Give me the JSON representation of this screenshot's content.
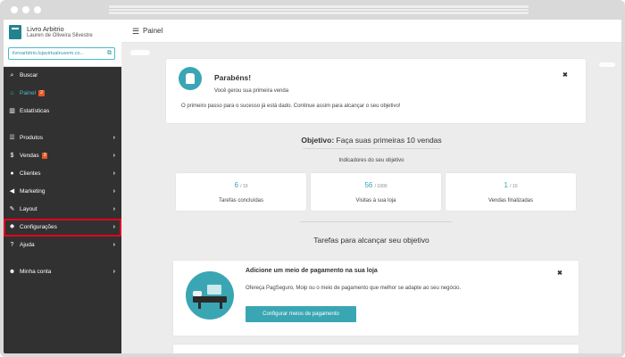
{
  "store": {
    "name": "Livro Arbitrio",
    "owner": "Lauren de Oliveira Silvestre",
    "url": "livroarbitrio.lojavirtualnuvem.co..."
  },
  "topbar": {
    "title": "Painel"
  },
  "sidebar": {
    "items": [
      {
        "label": "Buscar",
        "icon": "search-icon"
      },
      {
        "label": "Painel",
        "badge": "2",
        "icon": "home-icon"
      },
      {
        "label": "Estatísticas",
        "icon": "bar-chart-icon"
      },
      {
        "label": "Produtos",
        "icon": "list-icon"
      },
      {
        "label": "Vendas",
        "badge": "3",
        "icon": "dollar-icon"
      },
      {
        "label": "Clientes",
        "icon": "users-icon"
      },
      {
        "label": "Marketing",
        "icon": "megaphone-icon"
      },
      {
        "label": "Layout",
        "icon": "brush-icon"
      },
      {
        "label": "Configurações",
        "icon": "gear-icon"
      },
      {
        "label": "Ajuda",
        "icon": "help-icon"
      },
      {
        "label": "Minha conta",
        "icon": "user-icon"
      }
    ]
  },
  "congrats": {
    "title": "Parabéns!",
    "subtitle": "Você gerou sua primeira venda",
    "message": "O primeiro passo para o sucesso já está dado. Continue assim para alcançar o seu objetivo!"
  },
  "objective": {
    "label": "Objetivo:",
    "text": "Faça suas primeiras 10 vendas",
    "indicators_label": "Indicadores do seu objetivo"
  },
  "stats": [
    {
      "value": "6",
      "total": "/ 19",
      "label": "Tarefas concluídas"
    },
    {
      "value": "56",
      "total": "/ 1000",
      "label": "Visitas à sua loja"
    },
    {
      "value": "1",
      "total": "/ 10",
      "label": "Vendas finalizadas"
    }
  ],
  "tasks": {
    "title": "Tarefas para alcançar seu objetivo",
    "payment": {
      "title": "Adicione um meio de pagamento na sua loja",
      "description": "Ofereça PagSeguro, Moip ou o meio de pagamento que melhor se adapte ao seu negócio.",
      "button": "Configurar meios de pagamento"
    }
  },
  "colors": {
    "accent": "#3aa6b3",
    "sidebar": "#313131",
    "highlight": "#e3001b",
    "badge": "#e35a26"
  }
}
